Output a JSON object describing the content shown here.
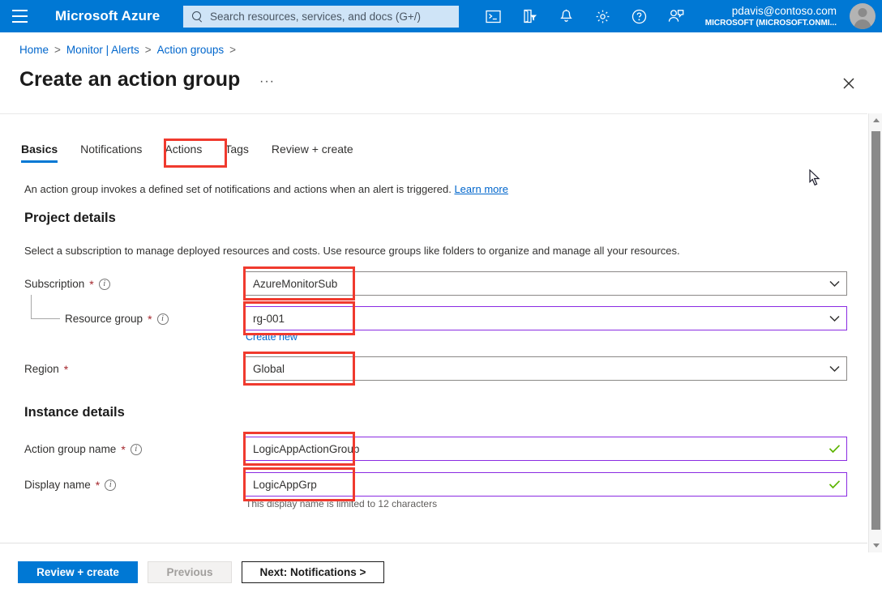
{
  "header": {
    "menu_icon": "hamburger-icon",
    "brand": "Microsoft Azure",
    "search_placeholder": "Search resources, services, and docs (G+/)",
    "icons": [
      "cloud-shell-icon",
      "directories-filter-icon",
      "notifications-bell-icon",
      "settings-gear-icon",
      "help-question-icon",
      "feedback-smiley-icon"
    ],
    "account_email": "pdavis@contoso.com",
    "account_tenant": "MICROSOFT (MICROSOFT.ONMI...",
    "avatar": "user-avatar"
  },
  "breadcrumb": {
    "items": [
      "Home",
      "Monitor | Alerts",
      "Action groups"
    ],
    "separator": ">"
  },
  "page": {
    "title": "Create an action group",
    "more_label": "···",
    "close_icon": "close-icon"
  },
  "tabs": [
    {
      "label": "Basics",
      "active": true
    },
    {
      "label": "Notifications",
      "active": false
    },
    {
      "label": "Actions",
      "active": false
    },
    {
      "label": "Tags",
      "active": false
    },
    {
      "label": "Review + create",
      "active": false
    }
  ],
  "description": {
    "text": "An action group invokes a defined set of notifications and actions when an alert is triggered.",
    "link": "Learn more"
  },
  "sections": {
    "project_details": {
      "heading": "Project details",
      "subtext": "Select a subscription to manage deployed resources and costs. Use resource groups like folders to organize and manage all your resources."
    },
    "instance_details": {
      "heading": "Instance details"
    }
  },
  "fields": {
    "subscription": {
      "label": "Subscription",
      "required": "*",
      "info": "info-icon",
      "value": "AzureMonitorSub",
      "control": "chevron-down-icon"
    },
    "resource_group": {
      "label": "Resource group",
      "required": "*",
      "info": "info-icon",
      "value": "rg-001",
      "control": "chevron-down-icon",
      "create_new": "Create new"
    },
    "region": {
      "label": "Region",
      "required": "*",
      "value": "Global",
      "control": "chevron-down-icon"
    },
    "action_group_name": {
      "label": "Action group name",
      "required": "*",
      "info": "info-icon",
      "value": "LogicAppActionGroup",
      "control": "valid-check-icon"
    },
    "display_name": {
      "label": "Display name",
      "required": "*",
      "info": "info-icon",
      "value": "LogicAppGrp",
      "control": "valid-check-icon",
      "helper": "This display name is limited to 12 characters"
    }
  },
  "footer": {
    "review_create": "Review + create",
    "previous": "Previous",
    "next": "Next: Notifications >"
  },
  "scrollbar": {
    "up_icon": "scroll-up-arrow-icon",
    "down_icon": "scroll-down-arrow-icon"
  },
  "colors": {
    "azure_blue": "#0078d4",
    "link_blue": "#0066cc",
    "highlight_red": "#f03a2e",
    "focus_purple": "#8a2be2",
    "valid_green": "#5cb400",
    "required_red": "#a4262c"
  }
}
